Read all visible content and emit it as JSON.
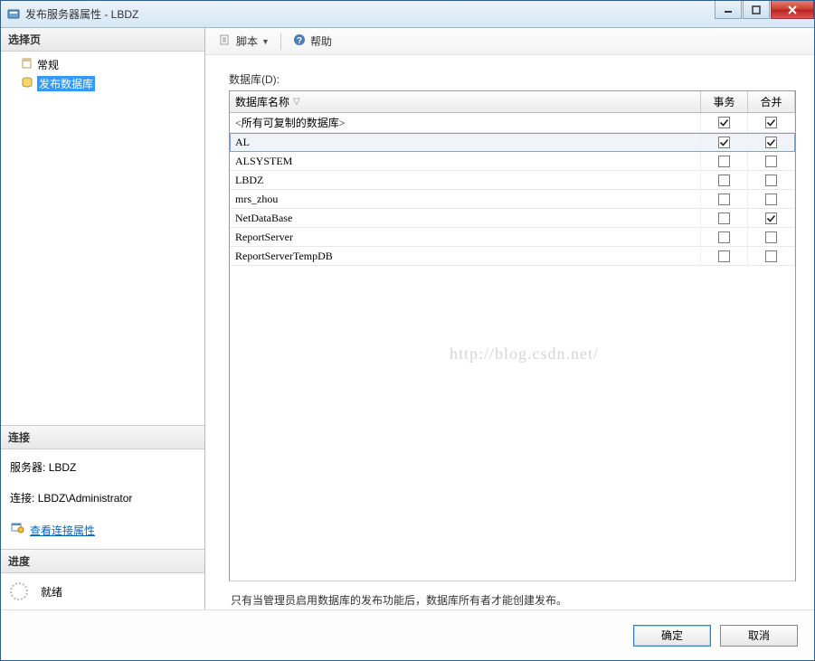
{
  "window": {
    "title": "发布服务器属性 - LBDZ"
  },
  "left": {
    "select_page_header": "选择页",
    "tree": [
      {
        "label": "常规",
        "selected": false
      },
      {
        "label": "发布数据库",
        "selected": true
      }
    ],
    "connection_header": "连接",
    "server_label": "服务器:",
    "server_value": "LBDZ",
    "conn_label": "连接:",
    "conn_value": "LBDZ\\Administrator",
    "view_conn_link": "查看连接属性",
    "progress_header": "进度",
    "progress_status": "就绪"
  },
  "toolbar": {
    "script_label": "脚本",
    "help_label": "帮助"
  },
  "main": {
    "databases_label": "数据库(D):",
    "columns": {
      "name": "数据库名称",
      "trans": "事务",
      "merge": "合并"
    },
    "rows": [
      {
        "name": "<所有可复制的数据库>",
        "trans": true,
        "merge": true,
        "selected": false
      },
      {
        "name": "AL",
        "trans": true,
        "merge": true,
        "selected": true
      },
      {
        "name": "ALSYSTEM",
        "trans": false,
        "merge": false,
        "selected": false
      },
      {
        "name": "LBDZ",
        "trans": false,
        "merge": false,
        "selected": false
      },
      {
        "name": "mrs_zhou",
        "trans": false,
        "merge": false,
        "selected": false
      },
      {
        "name": "NetDataBase",
        "trans": false,
        "merge": true,
        "selected": false
      },
      {
        "name": "ReportServer",
        "trans": false,
        "merge": false,
        "selected": false
      },
      {
        "name": "ReportServerTempDB",
        "trans": false,
        "merge": false,
        "selected": false
      }
    ],
    "hint": "只有当管理员启用数据库的发布功能后，数据库所有者才能创建发布。",
    "watermark": "http://blog.csdn.net/"
  },
  "footer": {
    "ok": "确定",
    "cancel": "取消"
  }
}
